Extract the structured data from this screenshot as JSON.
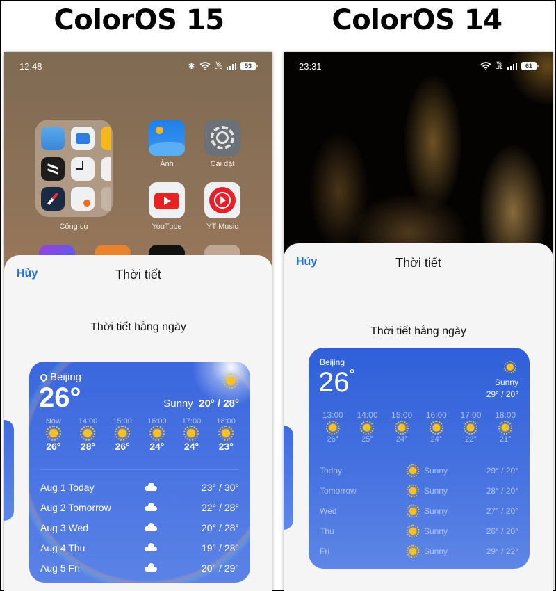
{
  "titles": {
    "left": "ColorOS 15",
    "right": "ColorOS 14"
  },
  "colors": {
    "accent": "#1e6fd9",
    "widget_blue": "#3b67de",
    "sun": "#ffc21a"
  },
  "coloros15": {
    "status": {
      "time": "12:48",
      "battery": "53",
      "icons": [
        "bluetooth-icon",
        "wifi-icon",
        "volte-icon",
        "signal-icon",
        "battery-icon"
      ]
    },
    "home": {
      "folder_label": "Công cụ",
      "apps": [
        {
          "label": "Ảnh",
          "icon": "photos-icon"
        },
        {
          "label": "Cài đặt",
          "icon": "settings-icon"
        },
        {
          "label": "YouTube",
          "icon": "youtube-icon"
        },
        {
          "label": "YT Music",
          "icon": "yt-music-icon"
        }
      ]
    },
    "sheet": {
      "cancel": "Hủy",
      "title": "Thời tiết",
      "widget_label": "Thời tiết hằng ngày",
      "widget": {
        "city": "Beijing",
        "temp": "26°",
        "condition": "Sunny",
        "range": "20° / 28°",
        "hourly": [
          {
            "time": "Now",
            "temp": "26°"
          },
          {
            "time": "14:00",
            "temp": "28°"
          },
          {
            "time": "15:00",
            "temp": "26°"
          },
          {
            "time": "16:00",
            "temp": "24°"
          },
          {
            "time": "17:00",
            "temp": "24°"
          },
          {
            "time": "18:00",
            "temp": "23°"
          }
        ],
        "daily": [
          {
            "day": "Aug 1 Today",
            "range": "23° / 30°"
          },
          {
            "day": "Aug 2 Tomorrow",
            "range": "22° / 28°"
          },
          {
            "day": "Aug 3 Wed",
            "range": "20° / 28°"
          },
          {
            "day": "Aug 4 Thu",
            "range": "19° / 28°"
          },
          {
            "day": "Aug 5 Fri",
            "range": "20° / 29°"
          }
        ]
      }
    }
  },
  "coloros14": {
    "status": {
      "time": "23:31",
      "battery": "61",
      "icons": [
        "wifi-icon",
        "volte-icon",
        "signal-icon",
        "battery-icon"
      ]
    },
    "sheet": {
      "cancel": "Hủy",
      "title": "Thời tiết",
      "widget_label": "Thời tiết hằng ngày",
      "widget": {
        "city": "Beijing",
        "temp": "26",
        "degree": "°",
        "condition": "Sunny",
        "range": "29° / 20°",
        "hourly": [
          {
            "time": "13:00",
            "temp": "26°"
          },
          {
            "time": "14:00",
            "temp": "25°"
          },
          {
            "time": "15:00",
            "temp": "24°"
          },
          {
            "time": "16:00",
            "temp": "24°"
          },
          {
            "time": "17:00",
            "temp": "22°"
          },
          {
            "time": "18:00",
            "temp": "21°"
          }
        ],
        "daily": [
          {
            "day": "Today",
            "condition": "Sunny",
            "range": "29° / 20°"
          },
          {
            "day": "Tomorrow",
            "condition": "Sunny",
            "range": "28° / 20°"
          },
          {
            "day": "Wed",
            "condition": "Sunny",
            "range": "27° / 20°"
          },
          {
            "day": "Thu",
            "condition": "Sunny",
            "range": "26° / 20°"
          },
          {
            "day": "Fri",
            "condition": "Sunny",
            "range": "29° / 22°"
          }
        ]
      }
    }
  }
}
